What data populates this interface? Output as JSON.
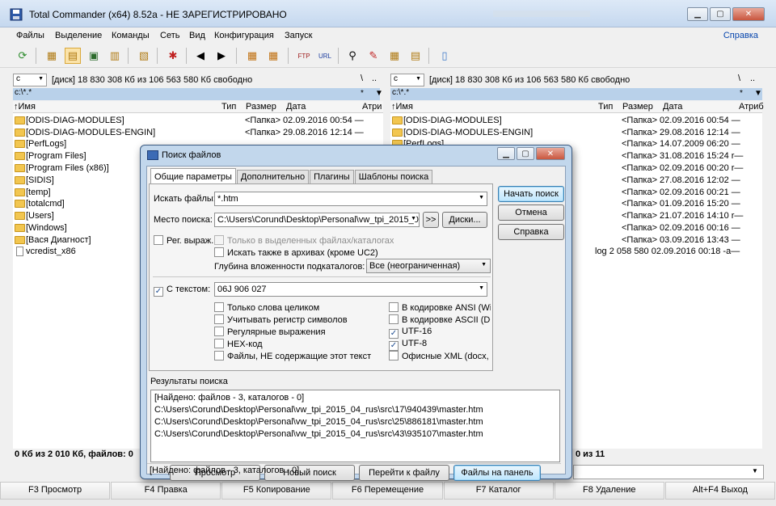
{
  "window": {
    "title": "Total Commander (x64) 8.52a - НЕ ЗАРЕГИСТРИРОВАНО",
    "menu": [
      "Файлы",
      "Выделение",
      "Команды",
      "Сеть",
      "Вид",
      "Конфигурация",
      "Запуск"
    ],
    "menu_help": "Справка"
  },
  "left": {
    "drive": "c",
    "drive_info": "[диск]  18 830 308 Кб из 106 563 580 Кб свободно",
    "path": "c:\\*.*",
    "path_filter": "*",
    "headers": {
      "name": "↑Имя",
      "type": "Тип",
      "size": "Размер",
      "date": "Дата",
      "attr": "Атри"
    },
    "rows": [
      {
        "name": "[ODIS-DIAG-MODULES]",
        "info": "<Папка> 02.09.2016 00:54 —",
        "kind": "folder"
      },
      {
        "name": "[ODIS-DIAG-MODULES-ENGIN]",
        "info": "<Папка> 29.08.2016 12:14 —",
        "kind": "folder"
      },
      {
        "name": "[PerfLogs]",
        "info": "",
        "kind": "folder"
      },
      {
        "name": "[Program Files]",
        "info": "",
        "kind": "folder"
      },
      {
        "name": "[Program Files (x86)]",
        "info": "",
        "kind": "folder"
      },
      {
        "name": "[SIDIS]",
        "info": "",
        "kind": "folder"
      },
      {
        "name": "[temp]",
        "info": "",
        "kind": "folder"
      },
      {
        "name": "[totalcmd]",
        "info": "",
        "kind": "folder"
      },
      {
        "name": "[Users]",
        "info": "",
        "kind": "folder"
      },
      {
        "name": "[Windows]",
        "info": "",
        "kind": "folder"
      },
      {
        "name": "[Вася Диагност]",
        "info": "",
        "kind": "folder"
      },
      {
        "name": "vcredist_x86",
        "info": "",
        "kind": "file"
      }
    ],
    "status": "0 Кб из 2 010 Кб, файлов: 0"
  },
  "right": {
    "drive": "c",
    "drive_info": "[диск]  18 830 308 Кб из 106 563 580 Кб свободно",
    "path": "c:\\*.*",
    "path_filter": "*",
    "headers": {
      "name": "↑Имя",
      "type": "Тип",
      "size": "Размер",
      "date": "Дата",
      "attr": "Атриб"
    },
    "rows": [
      {
        "name": "[ODIS-DIAG-MODULES]",
        "info": "<Папка> 02.09.2016 00:54 —",
        "kind": "folder"
      },
      {
        "name": "[ODIS-DIAG-MODULES-ENGIN]",
        "info": "<Папка> 29.08.2016 12:14 —",
        "kind": "folder"
      },
      {
        "name": "[PerfLogs]",
        "info": "<Папка> 14.07.2009 06:20 —",
        "kind": "folder"
      },
      {
        "name": "",
        "info": "<Папка> 31.08.2016 15:24 r—",
        "kind": "folder"
      },
      {
        "name": "",
        "info": "<Папка> 02.09.2016 00:20 r—",
        "kind": "folder"
      },
      {
        "name": "",
        "info": "<Папка> 27.08.2016 12:02 —",
        "kind": "folder"
      },
      {
        "name": "",
        "info": "<Папка> 02.09.2016 00:21 —",
        "kind": "folder"
      },
      {
        "name": "",
        "info": "<Папка> 01.09.2016 15:20 —",
        "kind": "folder"
      },
      {
        "name": "",
        "info": "<Папка> 21.07.2016 14:10 r—",
        "kind": "folder"
      },
      {
        "name": "",
        "info": "<Папка> 02.09.2016 00:16 —",
        "kind": "folder"
      },
      {
        "name": "",
        "info": "<Папка> 03.09.2016 13:43 —",
        "kind": "folder"
      },
      {
        "name": "",
        "info": "log  2 058 580 02.09.2016 00:18 -a—",
        "kind": "file"
      }
    ],
    "status": "0 из 11"
  },
  "fkeys": [
    "F3 Просмотр",
    "F4 Правка",
    "F5 Копирование",
    "F6 Перемещение",
    "F7 Каталог",
    "F8 Удаление",
    "Alt+F4 Выход"
  ],
  "dialog": {
    "title": "Поиск файлов",
    "tabs": [
      "Общие параметры",
      "Дополнительно",
      "Плагины",
      "Шаблоны поиска"
    ],
    "search_files_label": "Искать файлы:",
    "search_files_value": "*.htm",
    "search_in_label": "Место поиска:",
    "search_in_value": "C:\\Users\\Corund\\Desktop\\Personal\\vw_tpi_2015_04",
    "browse_button": ">>",
    "drives_button": "Диски...",
    "regex_label": "Рег. выраж.",
    "only_selected": "Только в выделенных файлах/каталогах",
    "search_archives": "Искать также в архивах (кроме UC2)",
    "depth_label": "Глубина вложенности подкаталогов:",
    "depth_value": "Все (неограниченная)",
    "with_text_label": "С текстом:",
    "with_text_value": "06J 906 027",
    "opts_left": [
      "Только слова целиком",
      "Учитывать регистр символов",
      "Регулярные выражения",
      "HEX-код",
      "Файлы, НЕ содержащие этот текст"
    ],
    "opts_right": [
      "В кодировке ANSI (Wind",
      "В кодировке ASCII (DOS",
      "UTF-16",
      "UTF-8",
      "Офисные XML (docx, xlsx"
    ],
    "opts_right_checked": [
      false,
      false,
      true,
      true,
      false
    ],
    "start_button": "Начать поиск",
    "cancel_button": "Отмена",
    "help_button": "Справка",
    "results_label": "Результаты поиска",
    "results": [
      "[Найдено: файлов - 3, каталогов - 0]",
      "C:\\Users\\Corund\\Desktop\\Personal\\vw_tpi_2015_04_rus\\src\\17\\940439\\master.htm",
      "C:\\Users\\Corund\\Desktop\\Personal\\vw_tpi_2015_04_rus\\src\\25\\886181\\master.htm",
      "C:\\Users\\Corund\\Desktop\\Personal\\vw_tpi_2015_04_rus\\src\\43\\935107\\master.htm"
    ],
    "view_button": "Просмотр",
    "new_search_button": "Новый поиск",
    "goto_button": "Перейти к файлу",
    "to_panel_button": "Файлы на панель",
    "status": "[Найдено: файлов - 3, каталогов - 0]"
  }
}
